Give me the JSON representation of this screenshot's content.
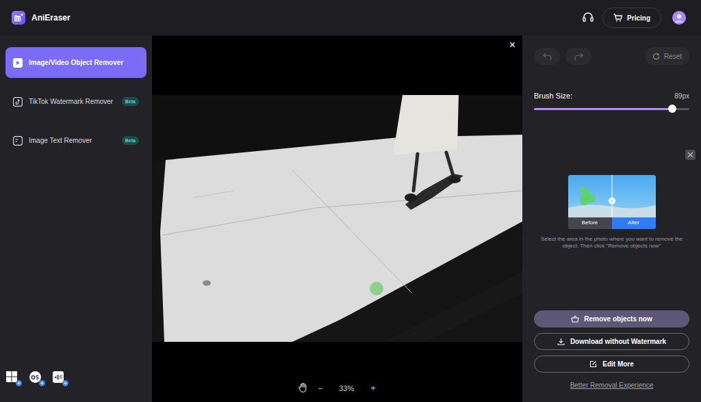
{
  "app": {
    "name": "AniEraser"
  },
  "header": {
    "pricing": "Pricing"
  },
  "sidebar": {
    "items": [
      {
        "label": "Image/Video Object Remover",
        "selected": true
      },
      {
        "label": "TikTok Watermark Remover",
        "selected": false,
        "badge": "Beta"
      },
      {
        "label": "Image Text Remover",
        "selected": false,
        "badge": "Beta"
      }
    ]
  },
  "canvas": {
    "close": "×",
    "zoom_out": "−",
    "zoom": "33%",
    "zoom_in": "+"
  },
  "panel": {
    "undo": {
      "disabled": true
    },
    "redo": {
      "disabled": true
    },
    "reset": "Reset",
    "brush": {
      "label": "Brush Size:",
      "reading": "89px",
      "level": 0.89
    },
    "preview": {
      "before": "Before",
      "after": "After"
    },
    "hint": "Select the area in the photo where you want to remove the object. Then click \"Remove objects now\"",
    "buttons": [
      {
        "label": "Remove objects now",
        "kind": "primary"
      },
      {
        "label": "Download without Watermark",
        "kind": "outline"
      },
      {
        "label": "Edit More",
        "kind": "outline"
      }
    ],
    "link": "Better Removal Experience"
  }
}
